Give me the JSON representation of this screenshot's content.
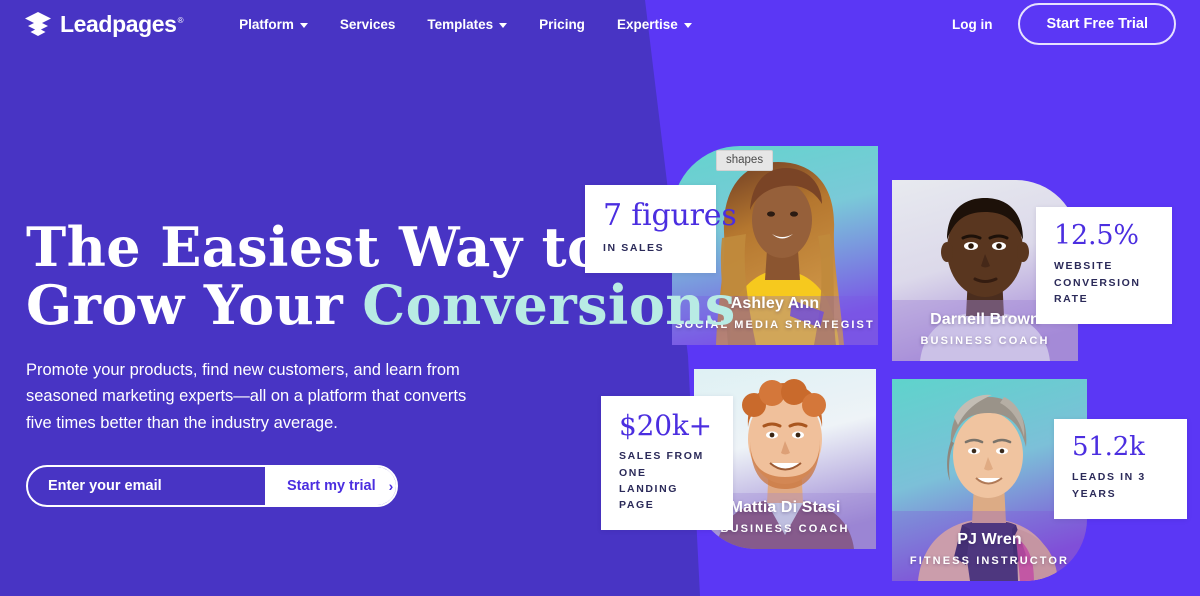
{
  "brand": {
    "name": "Leadpages",
    "trademark": "®",
    "logo_icon": "stacked-layers-icon",
    "colors": {
      "bg_dark_purple": "#4834C4",
      "bg_light_purple": "#5B37F5",
      "accent_mint": "#B8EBE4",
      "stat_purple": "#4B2EE0",
      "stat_label_navy": "#2B2A59",
      "white": "#FFFFFF"
    }
  },
  "header": {
    "nav": [
      {
        "label": "Platform",
        "has_caret": true,
        "icon": "chevron-down-icon"
      },
      {
        "label": "Services",
        "has_caret": false,
        "icon": ""
      },
      {
        "label": "Templates",
        "has_caret": true,
        "icon": "chevron-down-icon"
      },
      {
        "label": "Pricing",
        "has_caret": false,
        "icon": ""
      },
      {
        "label": "Expertise",
        "has_caret": true,
        "icon": "chevron-down-icon"
      }
    ],
    "login_label": "Log in",
    "trial_label": "Start Free Trial"
  },
  "hero": {
    "headline_line1": "The Easiest Way to",
    "headline_line2_plain": "Grow Your ",
    "headline_line2_accent": "Conversions",
    "subhead": "Promote your products, find new customers, and learn from seasoned marketing experts—all on a platform that converts five times better than the industry average.",
    "form": {
      "email_placeholder": "Enter your email",
      "email_value": "",
      "submit_label": "Start my trial",
      "submit_icon": "chevron-right-icon",
      "submit_chevron": "›"
    }
  },
  "collage": {
    "shapes_badge": "shapes",
    "people": [
      {
        "id": "ashley",
        "name": "Ashley Ann",
        "role": "SOCIAL MEDIA STRATEGIST"
      },
      {
        "id": "darnell",
        "name": "Darnell Brown",
        "role": "BUSINESS COACH"
      },
      {
        "id": "mattia",
        "name": "Mattia Di Stasi",
        "role": "BUSINESS COACH"
      },
      {
        "id": "pj",
        "name": "PJ Wren",
        "role": "FITNESS INSTRUCTOR"
      }
    ],
    "stats": [
      {
        "id": "figures",
        "value": "7 figures",
        "label": "IN SALES"
      },
      {
        "id": "conversion",
        "value": "12.5%",
        "label": "WEBSITE\nCONVERSION RATE"
      },
      {
        "id": "sales",
        "value": "$20k+",
        "label": "SALES FROM ONE\nLANDING PAGE"
      },
      {
        "id": "leads",
        "value": "51.2k",
        "label": "LEADS IN 3 YEARS"
      }
    ]
  }
}
